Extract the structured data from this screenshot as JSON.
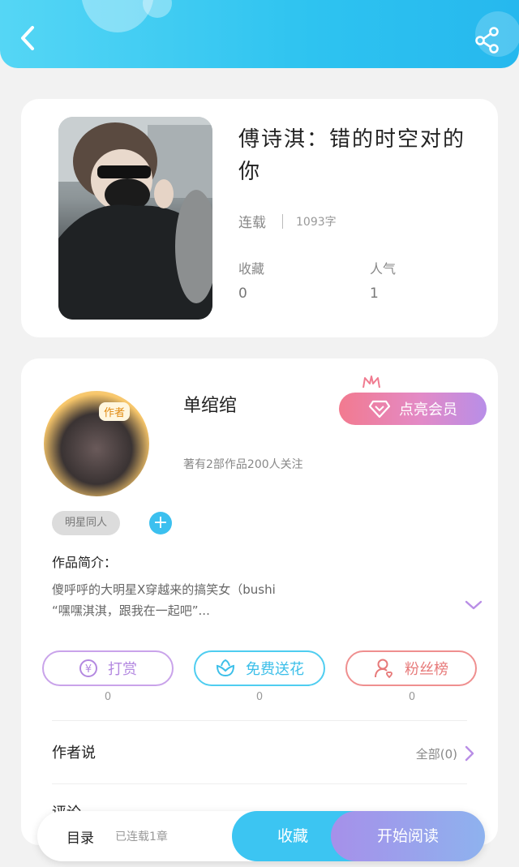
{
  "colors": {
    "header": "#2ec3f0",
    "accent_blue": "#3cc0ef",
    "vip_gradient_start": "#f27a8f",
    "vip_gradient_end": "#b88ee8",
    "reward_border": "#c9a3ea",
    "flower_border": "#4fcdf0",
    "fans_border": "#ef8f8f"
  },
  "header": {
    "back_icon": "chevron-left-icon",
    "share_icon": "share-icon"
  },
  "book": {
    "title": "傅诗淇：错的时空对的你",
    "status": "连载",
    "word_count": "1093字",
    "stats": [
      {
        "label": "收藏",
        "value": "0"
      },
      {
        "label": "人气",
        "value": "1"
      }
    ]
  },
  "author": {
    "tag": "作者",
    "name": "单绾绾",
    "meta": "著有2部作品200人关注",
    "vip_label": "点亮会员"
  },
  "tags": [
    "明星同人"
  ],
  "intro": {
    "label": "作品简介：",
    "line1": "傻呼呼的大明星X穿越来的搞笑女（bushi",
    "line2": "“嘿嘿淇淇，跟我在一起吧”..."
  },
  "actions": [
    {
      "label": "打赏",
      "count": "0",
      "icon": "yuan-icon"
    },
    {
      "label": "免费送花",
      "count": "0",
      "icon": "flower-icon"
    },
    {
      "label": "粉丝榜",
      "count": "0",
      "icon": "fans-icon"
    }
  ],
  "author_says": {
    "label": "作者说",
    "right": "全部(0)"
  },
  "comments": {
    "label": "评论"
  },
  "bottom_bar": {
    "toc_label": "目录",
    "toc_status": "已连载1章",
    "favorite_label": "收藏",
    "read_label": "开始阅读"
  }
}
